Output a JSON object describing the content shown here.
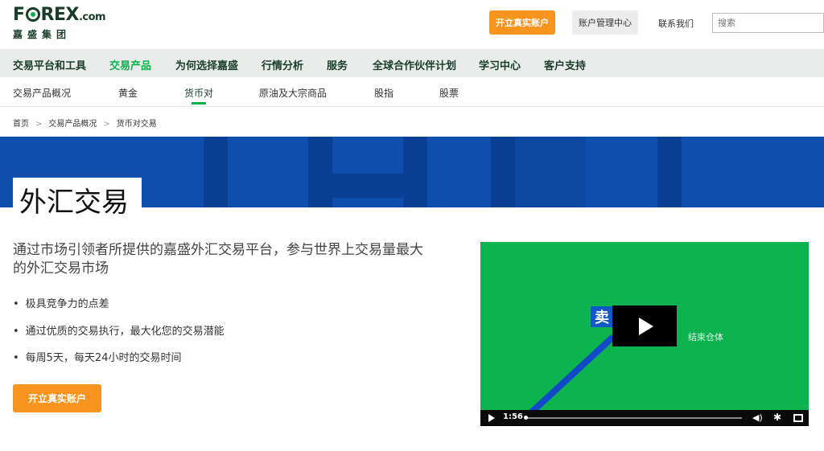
{
  "header": {
    "logo_text_left": "F",
    "logo_text_right": "REX",
    "logo_com": ".com",
    "logo_sub": "嘉盛集团",
    "open_account_label": "开立真实账户",
    "account_center_label": "账户管理中心",
    "contact_label": "联系我们",
    "search_placeholder": "搜索"
  },
  "nav": {
    "items": [
      {
        "label": "交易平台和工具"
      },
      {
        "label": "交易产品"
      },
      {
        "label": "为何选择嘉盛"
      },
      {
        "label": "行情分析"
      },
      {
        "label": "服务"
      },
      {
        "label": "全球合作伙伴计划"
      },
      {
        "label": "学习中心"
      },
      {
        "label": "客户支持"
      }
    ],
    "active": "交易产品"
  },
  "subnav": {
    "items": [
      {
        "label": "交易产品概况"
      },
      {
        "label": "黄金"
      },
      {
        "label": "货币对"
      },
      {
        "label": "原油及大宗商品"
      },
      {
        "label": "股指"
      },
      {
        "label": "股票"
      }
    ],
    "active": "货币对"
  },
  "breadcrumb": {
    "items": [
      "首页",
      "交易产品概况",
      "货币对交易"
    ],
    "separator": ">"
  },
  "hero": {
    "title": "外汇交易"
  },
  "content": {
    "intro": "通过市场引领者所提供的嘉盛外汇交易平台，参与世界上交易量最大的外汇交易市场",
    "bullets": [
      "极具竞争力的点差",
      "通过优质的交易执行，最大化您的交易潜能",
      "每周5天，每天24小时的交易时间"
    ],
    "cta_label": "开立真实账户"
  },
  "video": {
    "label_char": "卖",
    "end_text": "结束仓体",
    "duration": "1:56",
    "progress": 0.0
  },
  "colors": {
    "brand_orange": "#f7941d",
    "brand_green": "#0db04b",
    "brand_dark": "#1a3d2a",
    "hero_blue": "#0e4fad"
  }
}
